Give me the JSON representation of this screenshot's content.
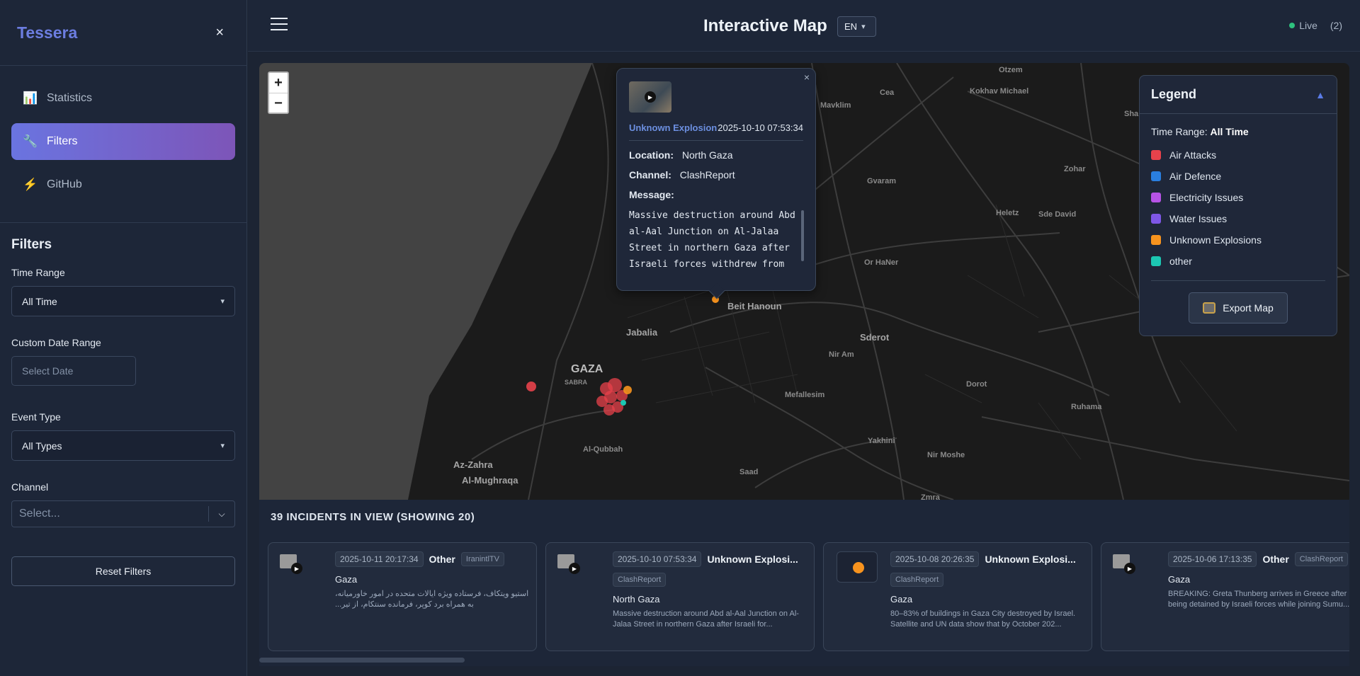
{
  "sidebar": {
    "brand": "Tessera",
    "close": "×",
    "nav": [
      {
        "label": "Statistics",
        "icon": "📊"
      },
      {
        "label": "Filters",
        "icon": "🔧"
      },
      {
        "label": "GitHub",
        "icon": "⚡"
      }
    ]
  },
  "filters": {
    "heading": "Filters",
    "time_range_label": "Time Range",
    "time_range_value": "All Time",
    "custom_date_label": "Custom Date Range",
    "date_placeholder": "Select Date",
    "event_type_label": "Event Type",
    "event_type_value": "All Types",
    "channel_label": "Channel",
    "channel_placeholder": "Select...",
    "reset_label": "Reset Filters"
  },
  "header": {
    "title": "Interactive Map",
    "lang": "EN",
    "live": "Live",
    "count": "(2)"
  },
  "map": {
    "zoom_in": "+",
    "zoom_out": "−",
    "places": [
      "Otzem",
      "Cea",
      "Kokhav Michael",
      "Mavklim",
      "Sha",
      "Zohar",
      "Gvaram",
      "Heletz",
      "Sde David",
      "Or HaNer",
      "Beit Hanoun",
      "Jabalia",
      "Sderot",
      "Nir Am",
      "GAZA",
      "SABRA",
      "Dorot",
      "Mefallesim",
      "Ruhama",
      "Yakhini",
      "Al-Qubbah",
      "Nir Moshe",
      "Az-Zahra",
      "Al-Mughraqa",
      "Saad",
      "Zmra"
    ]
  },
  "popup": {
    "event_type": "Unknown Explosion",
    "timestamp": "2025-10-10 07:53:34",
    "location_label": "Location:",
    "location": "North Gaza",
    "channel_label": "Channel:",
    "channel": "ClashReport",
    "message_label": "Message:",
    "message": "Massive destruction around Abd al-Aal Junction on Al-Jalaa Street in northern Gaza after Israeli forces withdrew from the area",
    "close": "×"
  },
  "legend": {
    "title": "Legend",
    "time_range_label": "Time Range:",
    "time_range_value": "All Time",
    "items": [
      {
        "label": "Air Attacks",
        "color": "#e8424b"
      },
      {
        "label": "Air Defence",
        "color": "#2a7fe0"
      },
      {
        "label": "Electricity Issues",
        "color": "#b653e6"
      },
      {
        "label": "Water Issues",
        "color": "#7e57e6"
      },
      {
        "label": "Unknown Explosions",
        "color": "#f7931e"
      },
      {
        "label": "other",
        "color": "#1cc7b3"
      }
    ],
    "export_label": "Export Map"
  },
  "incidents": {
    "title": "39 INCIDENTS IN VIEW (SHOWING 20)",
    "cards": [
      {
        "timestamp": "2025-10-11 20:17:34",
        "type": "Other",
        "channel": "IranintlTV",
        "location": "Gaza",
        "message": "استیو ویتکاف، فرستاده ویژه ایالات متحده در امور خاورمیانه، به همراه برد کوپر، فرمانده سنتکام، از تیر..."
      },
      {
        "timestamp": "2025-10-10 07:53:34",
        "type": "Unknown Explosi...",
        "channel": "ClashReport",
        "location": "North Gaza",
        "message": "Massive destruction around Abd al-Aal Junction on Al-Jalaa Street in northern Gaza after Israeli for..."
      },
      {
        "timestamp": "2025-10-08 20:26:35",
        "type": "Unknown Explosi...",
        "channel": "ClashReport",
        "location": "Gaza",
        "message": "80–83% of buildings in Gaza City destroyed by Israel. Satellite and UN data show that by October 202..."
      },
      {
        "timestamp": "2025-10-06 17:13:35",
        "type": "Other",
        "channel": "ClashReport",
        "location": "Gaza",
        "message": "BREAKING: Greta Thunberg arrives in Greece after being detained by Israeli forces while joining Sumu..."
      }
    ]
  }
}
